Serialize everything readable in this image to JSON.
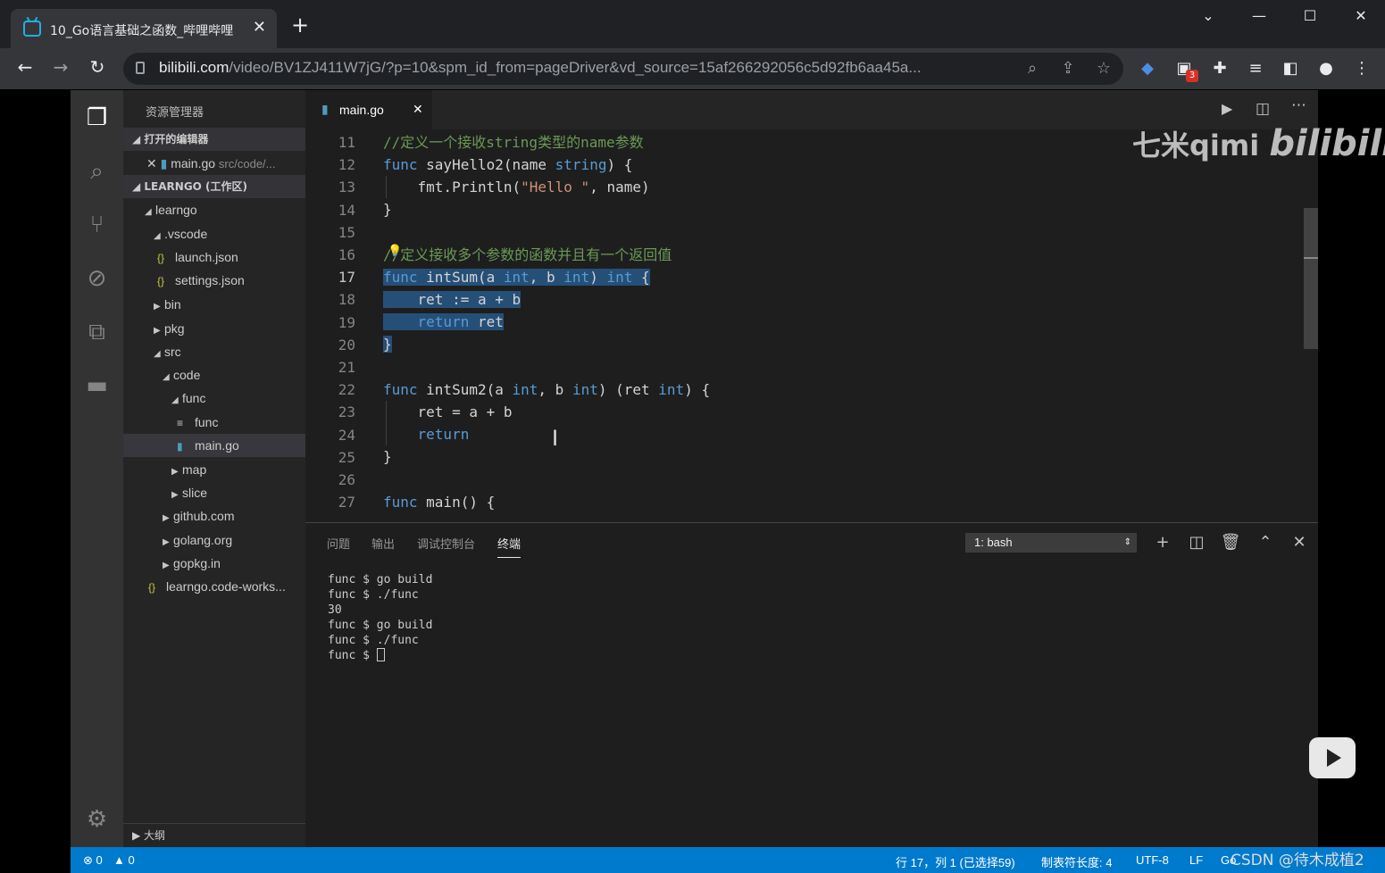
{
  "browser": {
    "tab_title": "10_Go语言基础之函数_哔哩哔哩",
    "url_domain": "bilibili.com",
    "url_path": "/video/BV1ZJ411W7jG/?p=10&spm_id_from=pageDriver&vd_source=15af266292056c5d92fb6aa45a...",
    "ext_badge": "3"
  },
  "sidebar": {
    "title": "资源管理器",
    "open_editors_label": "打开的编辑器",
    "open_file": "main.go",
    "open_file_path": "src/code/...",
    "workspace_label": "LEARNGO (工作区)",
    "tree": [
      "learngo",
      ".vscode",
      "launch.json",
      "settings.json",
      "bin",
      "pkg",
      "src",
      "code",
      "func",
      "func",
      "main.go",
      "map",
      "slice",
      "github.com",
      "golang.org",
      "gopkg.in",
      "learngo.code-works..."
    ],
    "outline_label": "大纲"
  },
  "editor": {
    "tab_label": "main.go",
    "line_numbers": [
      "11",
      "12",
      "13",
      "14",
      "15",
      "16",
      "17",
      "18",
      "19",
      "20",
      "21",
      "22",
      "23",
      "24",
      "25",
      "26",
      "27"
    ]
  },
  "code": {
    "l11": "//定义一个接收string类型的name参数",
    "l12a": "func",
    "l12b": " sayHello2(name ",
    "l12c": "string",
    "l12d": ") {",
    "l13a": "    fmt.Println(",
    "l13b": "\"Hello \"",
    "l13c": ", name)",
    "l14": "}",
    "l16": "//定义接收多个参数的函数并且有一个返回值",
    "l17a": "func",
    "l17b": " intSum(a ",
    "l17c": "int",
    "l17d": ", b ",
    "l17e": "int",
    "l17f": ") ",
    "l17g": "int",
    "l17h": " {",
    "l18": "    ret := a + b",
    "l19a": "    ",
    "l19b": "return",
    "l19c": " ret",
    "l20": "}",
    "l22a": "func",
    "l22b": " intSum2(a ",
    "l22c": "int",
    "l22d": ", b ",
    "l22e": "int",
    "l22f": ") (ret ",
    "l22g": "int",
    "l22h": ") {",
    "l23": "    ret = a + b",
    "l24a": "    ",
    "l24b": "return",
    "l25": "}",
    "l27a": "func",
    "l27b": " main() {"
  },
  "panel": {
    "tabs": [
      "问题",
      "输出",
      "调试控制台",
      "终端"
    ],
    "terminal_select": "1: bash",
    "terminal_lines": [
      "func $ go build",
      "func $ ./func",
      "30",
      "func $ go build",
      "func $ ./func",
      "func $ "
    ]
  },
  "status": {
    "errors": "0",
    "warnings": "0",
    "position": "行 17，列 1 (已选择59)",
    "tab_size": "制表符长度: 4",
    "encoding": "UTF-8",
    "eol": "LF",
    "lang": "Go"
  },
  "overlay": {
    "watermark": "七米qimi",
    "watermark_brand": "bilibili",
    "csdn": "CSDN @待木成植2"
  },
  "colors": {
    "status_bar": "#007acc",
    "selection": "#264f78",
    "keyword": "#569cd6",
    "comment": "#6a9955",
    "string": "#ce9178"
  }
}
